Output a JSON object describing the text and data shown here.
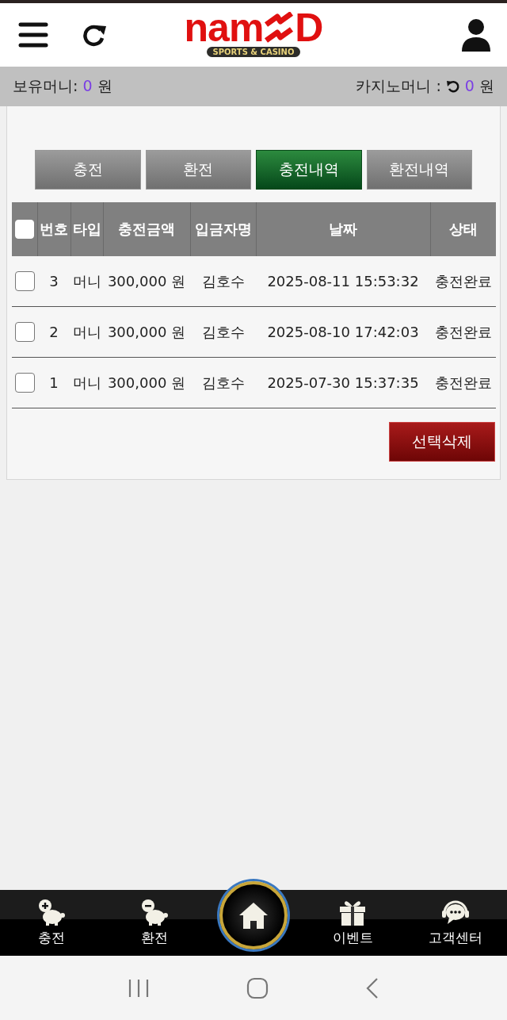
{
  "header": {
    "logo": {
      "left": "nam",
      "right": "D",
      "tagline": "SPORTS & CASINO"
    }
  },
  "balance": {
    "held_label": "보유머니:",
    "held_value": "0",
    "held_unit": "원",
    "casino_label": "카지노머니 :",
    "casino_value": "0",
    "casino_unit": "원"
  },
  "tabs": [
    {
      "label": "충전",
      "selected": false
    },
    {
      "label": "환전",
      "selected": false
    },
    {
      "label": "충전내역",
      "selected": true
    },
    {
      "label": "환전내역",
      "selected": false
    }
  ],
  "table": {
    "select_all_checked": false,
    "columns": [
      "번호",
      "타입",
      "충전금액",
      "입금자명",
      "날짜",
      "상태"
    ],
    "rows": [
      {
        "checked": false,
        "cells": [
          "3",
          "머니",
          "300,000 원",
          "김호수",
          "2025-08-11 15:53:32",
          "충전완료"
        ]
      },
      {
        "checked": false,
        "cells": [
          "2",
          "머니",
          "300,000 원",
          "김호수",
          "2025-08-10 17:42:03",
          "충전완료"
        ]
      },
      {
        "checked": false,
        "cells": [
          "1",
          "머니",
          "300,000 원",
          "김호수",
          "2025-07-30 15:37:35",
          "충전완료"
        ]
      }
    ]
  },
  "delete_button": "선택삭제",
  "bottom_nav": [
    {
      "kind": "deposit",
      "label": "충전"
    },
    {
      "kind": "withdraw",
      "label": "환전"
    },
    {
      "kind": "home"
    },
    {
      "kind": "event",
      "label": "이벤트"
    },
    {
      "kind": "support",
      "label": "고객센터"
    }
  ]
}
